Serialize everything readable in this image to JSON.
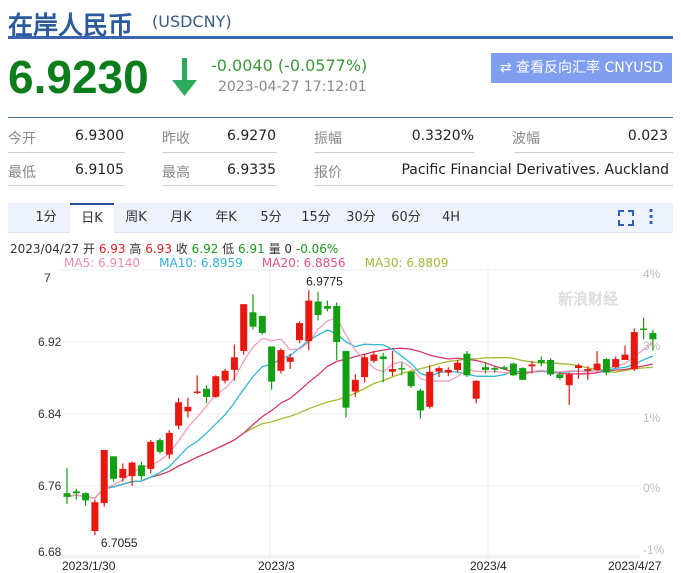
{
  "header": {
    "title": "在岸人民币",
    "symbol": "(USDCNY)",
    "price": "6.9230",
    "change": "-0.0040 (-0.0577%)",
    "time": "2023-04-27 17:12:01",
    "reverse_button": "查看反向汇率 CNYUSD",
    "colors": {
      "down": "#0b7d1c",
      "up": "#e0221b",
      "brand": "#3a64b0"
    }
  },
  "stats": [
    {
      "label": "今开",
      "value": "6.9300"
    },
    {
      "label": "昨收",
      "value": "6.9270"
    },
    {
      "label": "振幅",
      "value": "0.3320%"
    },
    {
      "label": "波幅",
      "value": "0.023"
    },
    {
      "label": "最低",
      "value": "6.9105"
    },
    {
      "label": "最高",
      "value": "6.9335"
    },
    {
      "label": "报价",
      "value": "Pacific Financial Derivatives. Auckland"
    }
  ],
  "tabs": [
    "1分",
    "日K",
    "周K",
    "月K",
    "年K",
    "5分",
    "15分",
    "30分",
    "60分",
    "4H"
  ],
  "active_tab": "日K",
  "info": {
    "date": "2023/04/27",
    "open_l": "开",
    "open": "6.93",
    "high_l": "高",
    "high": "6.93",
    "close_l": "收",
    "close": "6.92",
    "low_l": "低",
    "low": "6.91",
    "vol_l": "量",
    "vol": "0",
    "pct": "-0.06%"
  },
  "ma": {
    "ma5": "MA5: 6.9140",
    "ma10": "MA10: 6.8959",
    "ma20": "MA20: 6.8856",
    "ma30": "MA30: 6.8809"
  },
  "watermark": "新浪财经",
  "chart_data": {
    "type": "candlestick",
    "ylim": [
      6.68,
      7.0
    ],
    "y_ticks": [
      "7",
      "6.92",
      "6.84",
      "6.76",
      "6.68"
    ],
    "pct_ticks": [
      "4%",
      "3%",
      "1%",
      "0%",
      "-1%"
    ],
    "x_labels": [
      "2023/1/30",
      "2023/3",
      "2023/4",
      "2023/4/27"
    ],
    "max_label": "6.9775",
    "min_label": "6.7055",
    "candles": [
      [
        6.752,
        6.78,
        6.74,
        6.748
      ],
      [
        6.754,
        6.757,
        6.745,
        6.752
      ],
      [
        6.752,
        6.753,
        6.738,
        6.744
      ],
      [
        6.71,
        6.745,
        6.7055,
        6.742
      ],
      [
        6.741,
        6.8,
        6.737,
        6.8
      ],
      [
        6.793,
        6.793,
        6.765,
        6.768
      ],
      [
        6.769,
        6.785,
        6.765,
        6.779
      ],
      [
        6.771,
        6.787,
        6.76,
        6.786
      ],
      [
        6.783,
        6.787,
        6.767,
        6.771
      ],
      [
        6.779,
        6.811,
        6.774,
        6.809
      ],
      [
        6.811,
        6.813,
        6.796,
        6.798
      ],
      [
        6.795,
        6.822,
        6.79,
        6.819
      ],
      [
        6.827,
        6.858,
        6.823,
        6.853
      ],
      [
        6.843,
        6.858,
        6.836,
        6.848
      ],
      [
        6.864,
        6.883,
        6.862,
        6.865
      ],
      [
        6.868,
        6.872,
        6.852,
        6.859
      ],
      [
        6.859,
        6.883,
        6.858,
        6.882
      ],
      [
        6.877,
        6.89,
        6.874,
        6.888
      ],
      [
        6.889,
        6.917,
        6.877,
        6.903
      ],
      [
        6.91,
        6.962,
        6.906,
        6.962
      ],
      [
        6.953,
        6.973,
        6.934,
        6.937
      ],
      [
        6.949,
        6.949,
        6.928,
        6.93
      ],
      [
        6.915,
        6.915,
        6.867,
        6.876
      ],
      [
        6.888,
        6.913,
        6.885,
        6.911
      ],
      [
        6.898,
        6.907,
        6.89,
        6.903
      ],
      [
        6.922,
        6.943,
        6.919,
        6.941
      ],
      [
        6.921,
        6.9775,
        6.911,
        6.966
      ],
      [
        6.965,
        6.976,
        6.944,
        6.95
      ],
      [
        6.96,
        6.966,
        6.954,
        6.957
      ],
      [
        6.96,
        6.964,
        6.9,
        6.92
      ],
      [
        6.91,
        6.91,
        6.836,
        6.847
      ],
      [
        6.865,
        6.884,
        6.859,
        6.878
      ],
      [
        6.881,
        6.907,
        6.875,
        6.903
      ],
      [
        6.899,
        6.91,
        6.897,
        6.906
      ],
      [
        6.904,
        6.908,
        6.875,
        6.901
      ],
      [
        6.887,
        6.91,
        6.882,
        6.89
      ],
      [
        6.891,
        6.897,
        6.883,
        6.8905
      ],
      [
        6.887,
        6.888,
        6.869,
        6.871
      ],
      [
        6.866,
        6.868,
        6.835,
        6.844
      ],
      [
        6.848,
        6.894,
        6.846,
        6.887
      ],
      [
        6.887,
        6.893,
        6.881,
        6.891
      ],
      [
        6.886,
        6.892,
        6.882,
        6.889
      ],
      [
        6.889,
        6.9,
        6.886,
        6.897
      ],
      [
        6.907,
        6.91,
        6.881,
        6.883
      ],
      [
        6.857,
        6.877,
        6.852,
        6.877
      ],
      [
        6.892,
        6.897,
        6.885,
        6.889
      ],
      [
        6.891,
        6.893,
        6.886,
        6.8905
      ],
      [
        6.892,
        6.894,
        6.889,
        6.89
      ],
      [
        6.896,
        6.897,
        6.882,
        6.883
      ],
      [
        6.891,
        6.892,
        6.878,
        6.878
      ],
      [
        6.893,
        6.899,
        6.885,
        6.895
      ],
      [
        6.9,
        6.904,
        6.893,
        6.897
      ],
      [
        6.9,
        6.902,
        6.882,
        6.884
      ],
      [
        6.884,
        6.887,
        6.878,
        6.88
      ],
      [
        6.872,
        6.886,
        6.85,
        6.884
      ],
      [
        6.891,
        6.896,
        6.879,
        6.894
      ],
      [
        6.888,
        6.893,
        6.878,
        6.89
      ],
      [
        6.889,
        6.91,
        6.887,
        6.896
      ],
      [
        6.901,
        6.902,
        6.883,
        6.886
      ],
      [
        6.892,
        6.904,
        6.891,
        6.901
      ],
      [
        6.9,
        6.916,
        6.9,
        6.906
      ],
      [
        6.89,
        6.935,
        6.888,
        6.931
      ],
      [
        6.935,
        6.947,
        6.923,
        6.934
      ],
      [
        6.93,
        6.9335,
        6.9105,
        6.923
      ]
    ],
    "ma_colors": {
      "ma5": "#f0a0b8",
      "ma10": "#30b8d8",
      "ma20": "#d83a70",
      "ma30": "#a8b830"
    }
  }
}
